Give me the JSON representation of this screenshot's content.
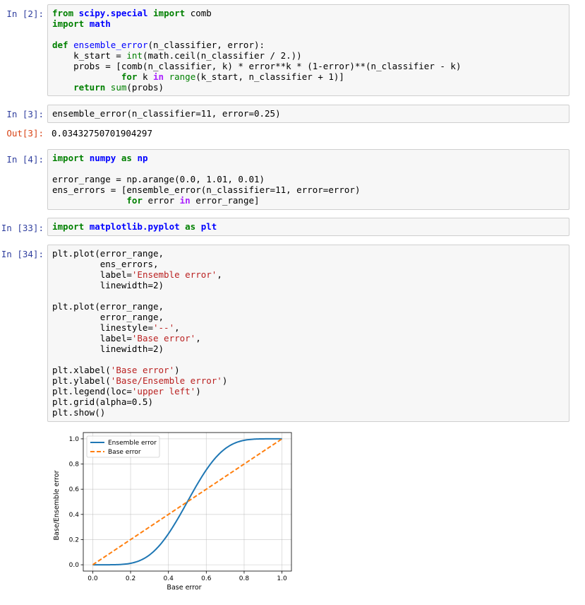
{
  "cells": [
    {
      "prompt": "In [2]:",
      "lines": [
        [
          [
            "kw",
            "from"
          ],
          [
            "",
            " "
          ],
          [
            "mod",
            "scipy.special"
          ],
          [
            "",
            " "
          ],
          [
            "kw",
            "import"
          ],
          [
            "",
            " comb"
          ]
        ],
        [
          [
            "kw",
            "import"
          ],
          [
            "",
            " "
          ],
          [
            "mod",
            "math"
          ]
        ],
        [
          [
            "",
            ""
          ]
        ],
        [
          [
            "kw",
            "def"
          ],
          [
            "",
            " "
          ],
          [
            "fn",
            "ensemble_error"
          ],
          [
            "",
            "(n_classifier, error):"
          ]
        ],
        [
          [
            "",
            "    k_start = "
          ],
          [
            "bi",
            "int"
          ],
          [
            "",
            "(math.ceil(n_classifier / 2.))"
          ]
        ],
        [
          [
            "",
            "    probs = [comb(n_classifier, k) * error**k * (1-error)**(n_classifier - k)"
          ]
        ],
        [
          [
            "",
            "             "
          ],
          [
            "kw",
            "for"
          ],
          [
            "",
            " k "
          ],
          [
            "kwo",
            "in"
          ],
          [
            "",
            " "
          ],
          [
            "bi",
            "range"
          ],
          [
            "",
            "(k_start, n_classifier + 1)]"
          ]
        ],
        [
          [
            "",
            "    "
          ],
          [
            "kw",
            "return"
          ],
          [
            "",
            " "
          ],
          [
            "bi",
            "sum"
          ],
          [
            "",
            "(probs)"
          ]
        ]
      ]
    },
    {
      "prompt": "In [3]:",
      "lines": [
        [
          [
            "",
            "ensemble_error(n_classifier=11, error=0.25)"
          ]
        ]
      ]
    },
    {
      "prompt": "In [4]:",
      "lines": [
        [
          [
            "kw",
            "import"
          ],
          [
            "",
            " "
          ],
          [
            "mod",
            "numpy"
          ],
          [
            "",
            " "
          ],
          [
            "kw",
            "as"
          ],
          [
            "",
            " "
          ],
          [
            "mod",
            "np"
          ]
        ],
        [
          [
            "",
            ""
          ]
        ],
        [
          [
            "",
            "error_range = np.arange(0.0, 1.01, 0.01)"
          ]
        ],
        [
          [
            "",
            "ens_errors = [ensemble_error(n_classifier=11, error=error)"
          ]
        ],
        [
          [
            "",
            "              "
          ],
          [
            "kw",
            "for"
          ],
          [
            "",
            " error "
          ],
          [
            "kwo",
            "in"
          ],
          [
            "",
            " error_range]"
          ]
        ]
      ]
    },
    {
      "prompt": "In [33]:",
      "lines": [
        [
          [
            "kw",
            "import"
          ],
          [
            "",
            " "
          ],
          [
            "mod",
            "matplotlib.pyplot"
          ],
          [
            "",
            " "
          ],
          [
            "kw",
            "as"
          ],
          [
            "",
            " "
          ],
          [
            "mod",
            "plt"
          ]
        ]
      ]
    },
    {
      "prompt": "In [34]:",
      "lines": [
        [
          [
            "",
            "plt.plot(error_range,"
          ]
        ],
        [
          [
            "",
            "         ens_errors,"
          ]
        ],
        [
          [
            "",
            "         label="
          ],
          [
            "str",
            "'Ensemble error'"
          ],
          [
            "",
            ","
          ]
        ],
        [
          [
            "",
            "         linewidth=2)"
          ]
        ],
        [
          [
            "",
            ""
          ]
        ],
        [
          [
            "",
            "plt.plot(error_range,"
          ]
        ],
        [
          [
            "",
            "         error_range,"
          ]
        ],
        [
          [
            "",
            "         linestyle="
          ],
          [
            "str",
            "'--'"
          ],
          [
            "",
            ","
          ]
        ],
        [
          [
            "",
            "         label="
          ],
          [
            "str",
            "'Base error'"
          ],
          [
            "",
            ","
          ]
        ],
        [
          [
            "",
            "         linewidth=2)"
          ]
        ],
        [
          [
            "",
            ""
          ]
        ],
        [
          [
            "",
            "plt.xlabel("
          ],
          [
            "str",
            "'Base error'"
          ],
          [
            "",
            ")"
          ]
        ],
        [
          [
            "",
            "plt.ylabel("
          ],
          [
            "str",
            "'Base/Ensemble error'"
          ],
          [
            "",
            ")"
          ]
        ],
        [
          [
            "",
            "plt.legend(loc="
          ],
          [
            "str",
            "'upper left'"
          ],
          [
            "",
            ")"
          ]
        ],
        [
          [
            "",
            "plt.grid(alpha=0.5)"
          ]
        ],
        [
          [
            "",
            "plt.show()"
          ]
        ]
      ]
    }
  ],
  "output3": {
    "prompt": "Out[3]:",
    "value": "0.03432750701904297"
  },
  "chart_data": {
    "type": "line",
    "xlabel": "Base error",
    "ylabel": "Base/Ensemble error",
    "xlim": [
      -0.05,
      1.05
    ],
    "ylim": [
      -0.05,
      1.05
    ],
    "xticks": [
      "0.0",
      "0.2",
      "0.4",
      "0.6",
      "0.8",
      "1.0"
    ],
    "yticks": [
      "0.0",
      "0.2",
      "0.4",
      "0.6",
      "0.8",
      "1.0"
    ],
    "grid": true,
    "legend_loc": "upper left",
    "series": [
      {
        "name": "Ensemble error",
        "color": "#1f77b4",
        "style": "solid",
        "x": [
          0.0,
          0.05,
          0.1,
          0.15,
          0.2,
          0.25,
          0.3,
          0.35,
          0.4,
          0.45,
          0.5,
          0.55,
          0.6,
          0.65,
          0.7,
          0.75,
          0.8,
          0.85,
          0.9,
          0.95,
          1.0
        ],
        "y": [
          0.0,
          0.0,
          0.0003,
          0.0027,
          0.0117,
          0.0343,
          0.0782,
          0.1487,
          0.2465,
          0.3669,
          0.5,
          0.6331,
          0.7535,
          0.8513,
          0.9218,
          0.9657,
          0.9883,
          0.9973,
          0.9997,
          1.0,
          1.0
        ]
      },
      {
        "name": "Base error",
        "color": "#ff7f0e",
        "style": "dashed",
        "x": [
          0.0,
          1.0
        ],
        "y": [
          0.0,
          1.0
        ]
      }
    ]
  },
  "colors": {
    "code_bg": "#f7f7f7",
    "prompt_in": "#303f9f",
    "prompt_out": "#d84315"
  }
}
